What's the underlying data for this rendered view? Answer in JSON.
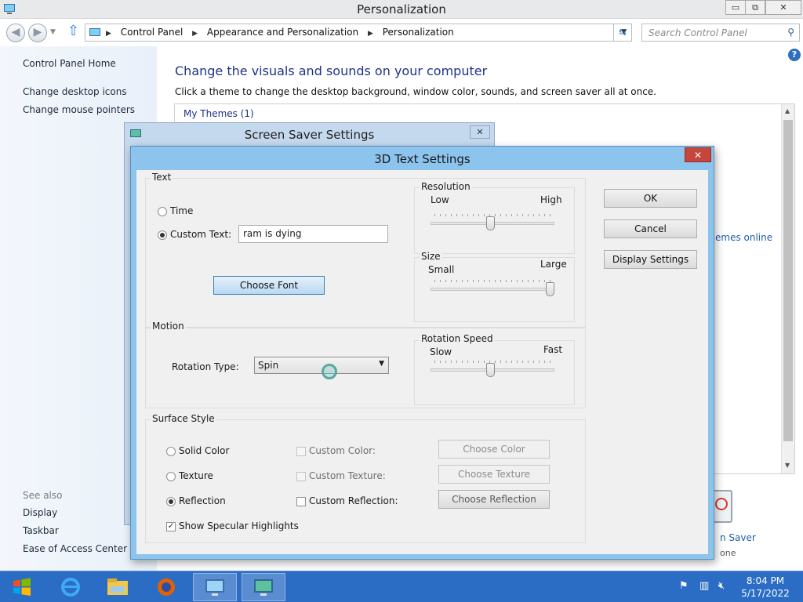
{
  "window": {
    "title": "Personalization",
    "caption_buttons": {
      "minimize": "▭",
      "maximize": "⧉",
      "close": "✕"
    }
  },
  "navbar": {
    "breadcrumbs": [
      "Control Panel",
      "Appearance and Personalization",
      "Personalization"
    ],
    "search_placeholder": "Search Control Panel"
  },
  "left_pane": {
    "home": "Control Panel Home",
    "links": [
      "Change desktop icons",
      "Change mouse pointers"
    ],
    "see_also_heading": "See also",
    "see_also": [
      "Display",
      "Taskbar",
      "Ease of Access Center"
    ]
  },
  "content": {
    "heading": "Change the visuals and sounds on your computer",
    "subtitle": "Click a theme to change the desktop background, window color, sounds, and screen saver all at once.",
    "my_themes": "My Themes (1)",
    "get_more_partial": "emes online",
    "screen_saver_partial": "n Saver",
    "screen_saver_value_partial": "one"
  },
  "screen_saver_dialog": {
    "title": "Screen Saver Settings"
  },
  "dialog": {
    "title": "3D Text Settings",
    "close_label": "✕",
    "text_group": {
      "title": "Text",
      "time_label": "Time",
      "custom_text_label": "Custom Text:",
      "custom_text_value": "ram is dying",
      "choose_font": "Choose Font",
      "selected": "custom"
    },
    "resolution": {
      "title": "Resolution",
      "low": "Low",
      "high": "High",
      "level": 0.48
    },
    "size": {
      "title": "Size",
      "small": "Small",
      "large": "Large",
      "level": 1.0
    },
    "motion_group": {
      "title": "Motion",
      "rotation_type_label": "Rotation Type:",
      "rotation_type_value": "Spin"
    },
    "rotation_speed": {
      "title": "Rotation Speed",
      "slow": "Slow",
      "fast": "Fast",
      "level": 0.48
    },
    "surface_group": {
      "title": "Surface Style",
      "solid_color": "Solid Color",
      "texture": "Texture",
      "reflection": "Reflection",
      "selected": "reflection",
      "custom_color": "Custom Color:",
      "custom_texture": "Custom Texture:",
      "custom_reflection": "Custom Reflection:",
      "choose_color": "Choose Color",
      "choose_texture": "Choose Texture",
      "choose_reflection": "Choose Reflection",
      "specular": "Show Specular Highlights",
      "specular_checked": true
    },
    "buttons": {
      "ok": "OK",
      "cancel": "Cancel",
      "display_settings": "Display Settings"
    }
  },
  "taskbar": {
    "clock_time": "8:04 PM",
    "clock_date": "5/17/2022"
  }
}
